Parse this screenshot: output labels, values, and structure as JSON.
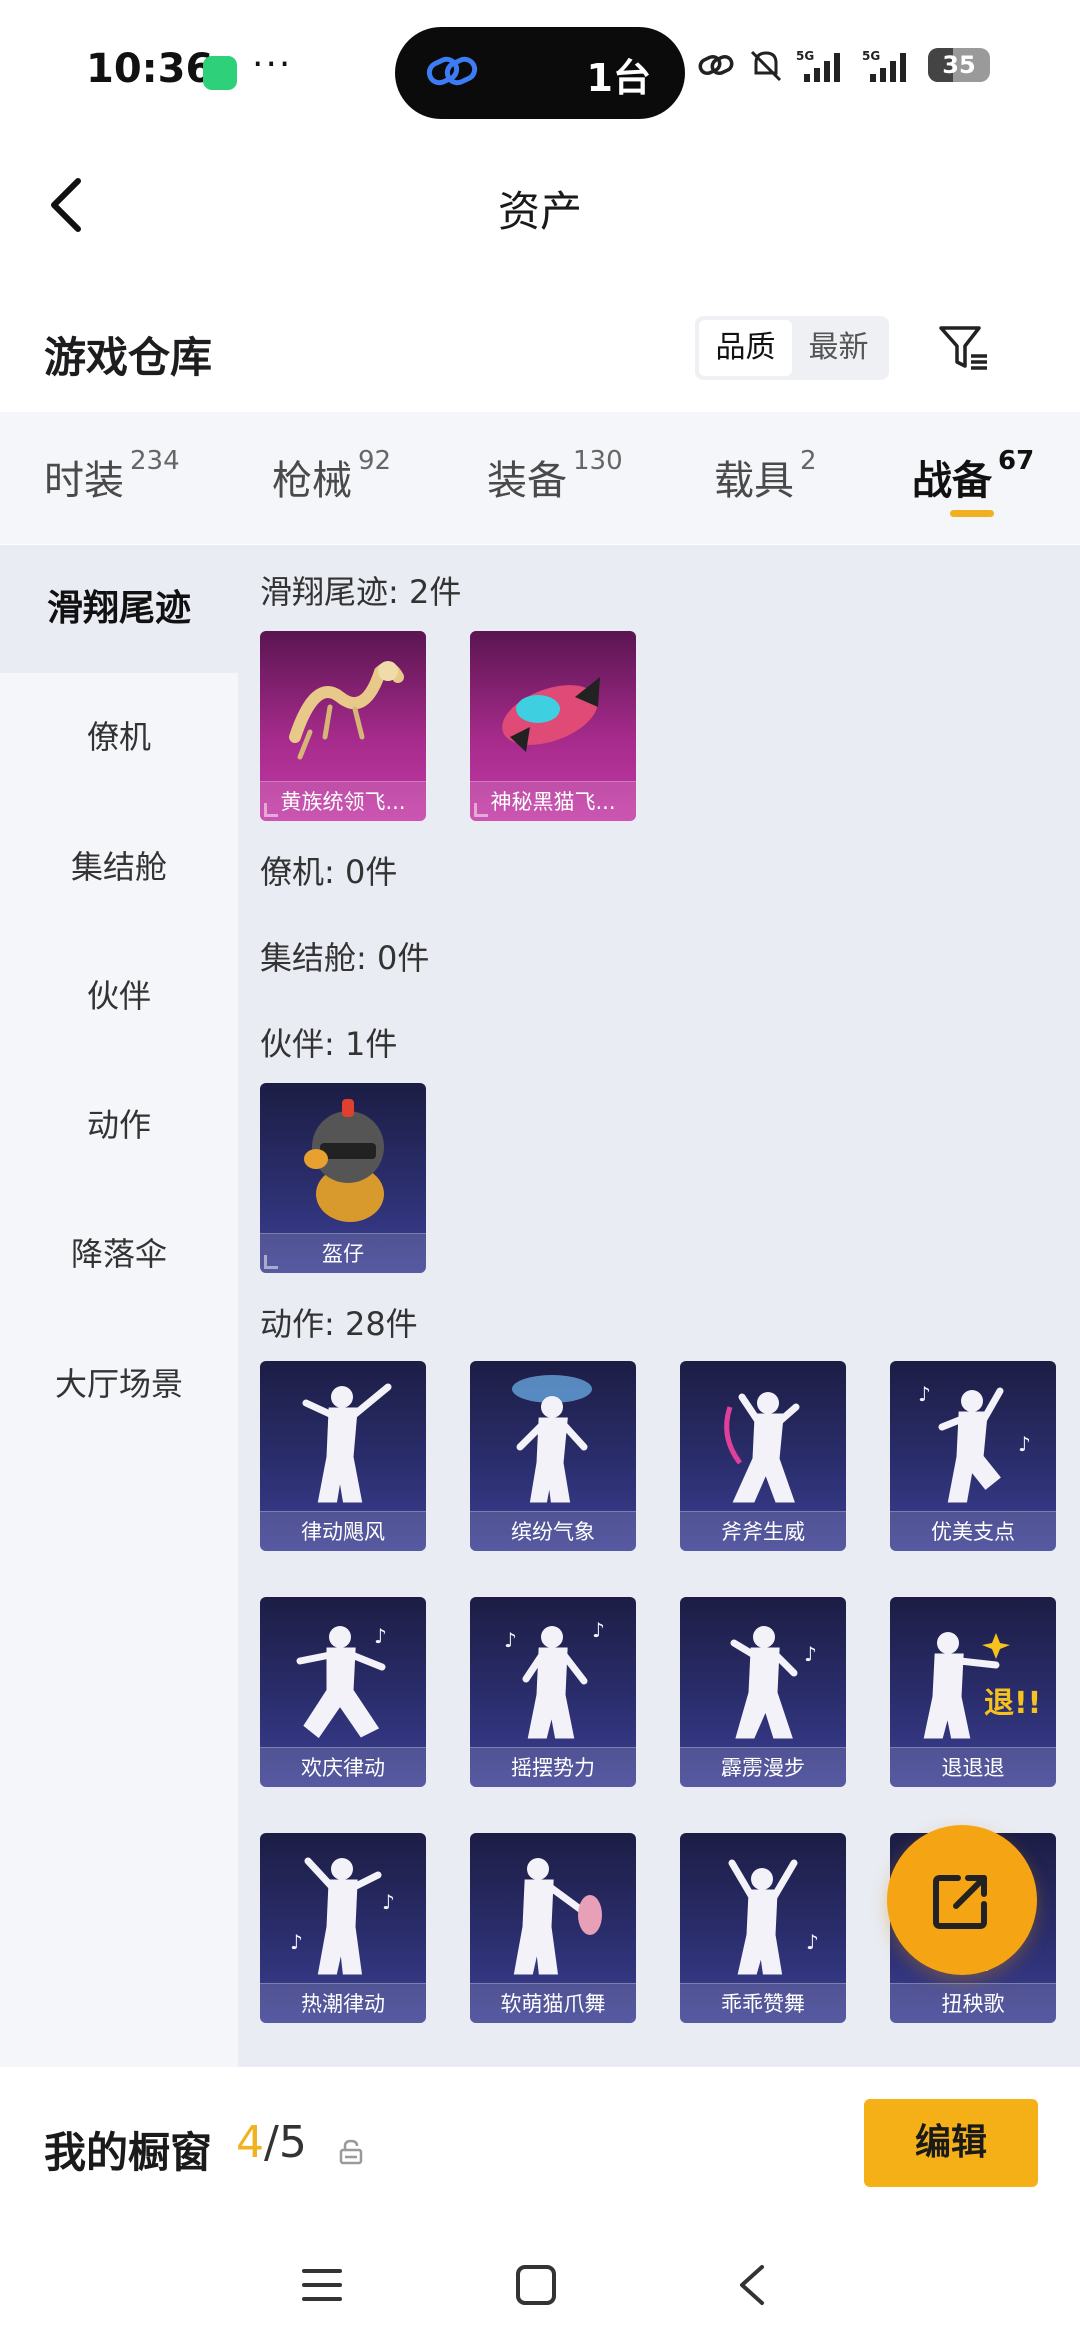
{
  "status_bar": {
    "time": "10:36",
    "dots": "···",
    "island_text": "1台",
    "battery": "35",
    "icons": [
      "app-icon",
      "link-icon",
      "mute-bell-icon",
      "signal-5g-icon",
      "signal-5g-icon",
      "battery-icon"
    ]
  },
  "header": {
    "title": "资产",
    "back_icon": "chevron-left-icon"
  },
  "warehouse": {
    "title": "游戏仓库",
    "sort_options": [
      "品质",
      "最新"
    ],
    "active_sort": "品质",
    "filter_icon": "filter-icon"
  },
  "tabs": [
    {
      "label": "时装",
      "count": "234"
    },
    {
      "label": "枪械",
      "count": "92"
    },
    {
      "label": "装备",
      "count": "130"
    },
    {
      "label": "载具",
      "count": "2"
    },
    {
      "label": "战备",
      "count": "67"
    }
  ],
  "active_tab": "战备",
  "categories": [
    "滑翔尾迹",
    "僚机",
    "集结舱",
    "伙伴",
    "动作",
    "降落伞",
    "大厅场景"
  ],
  "active_category": "滑翔尾迹",
  "sections": {
    "trail_label": "滑翔尾迹: 2件",
    "trail_items": [
      "黄族统领飞...",
      "神秘黑猫飞..."
    ],
    "wingman_label": "僚机: 0件",
    "pod_label": "集结舱: 0件",
    "partner_label": "伙伴: 1件",
    "partner_items": [
      "盔仔"
    ],
    "emote_label": "动作: 28件",
    "emote_items": [
      "律动飓风",
      "缤纷气象",
      "斧斧生威",
      "优美支点",
      "欢庆律动",
      "摇摆势力",
      "霹雳漫步",
      "退退退",
      "热潮律动",
      "软萌猫爪舞",
      "乖乖赞舞",
      "扭秧歌"
    ]
  },
  "fab_icon": "share-export-icon",
  "window_bar": {
    "label": "我的橱窗",
    "current": "4",
    "separator": "/",
    "total": "5",
    "edit_label": "编辑"
  },
  "sys_nav": [
    "menu-icon",
    "home-square-icon",
    "back-triangle-icon"
  ],
  "colors": {
    "accent": "#f5b018",
    "rare_purple": "#b0319a",
    "epic_blue": "#2b2e6e"
  }
}
